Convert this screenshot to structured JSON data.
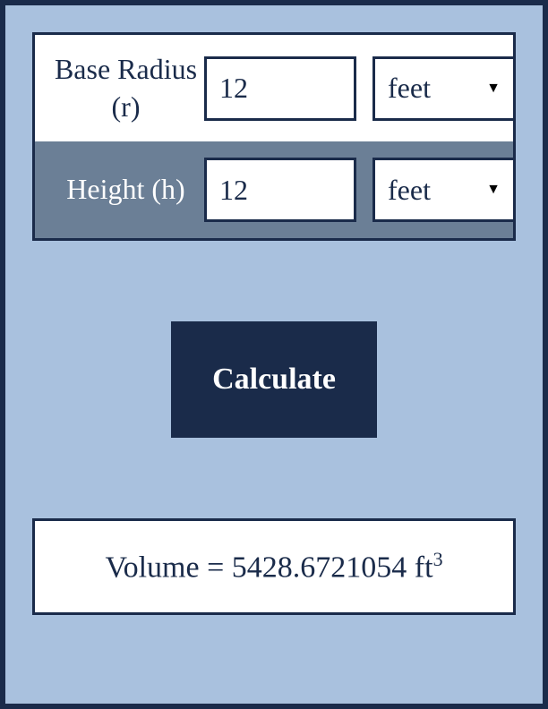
{
  "inputs": {
    "radius": {
      "label": "Base Radius (r)",
      "value": "12",
      "unit": "feet"
    },
    "height": {
      "label": "Height (h)",
      "value": "12",
      "unit": "feet"
    }
  },
  "calculate_button": "Calculate",
  "result": {
    "prefix": "Volume = ",
    "value": "5428.6721054",
    "unit": " ft",
    "exponent": "3"
  }
}
